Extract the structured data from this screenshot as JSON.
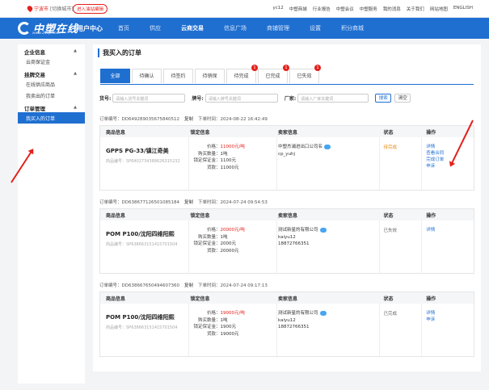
{
  "topbar": {
    "location": "宁波市",
    "location_note": "[切换城市]",
    "enter_label": "进入油站编辑",
    "links": [
      "yc12",
      "中塑商城",
      "行业报告",
      "中塑会议",
      "中塑服务",
      "我的消息",
      "关于我们",
      "网站地图",
      "ENGLISH"
    ]
  },
  "header": {
    "logo": "中塑在线",
    "logo_sub": "www.21cp.com",
    "user_center": "用户中心",
    "nav": [
      "首页",
      "供应",
      "云商交易",
      "信息广场",
      "商铺管理",
      "设置",
      "积分商城"
    ],
    "active_nav": "云商交易"
  },
  "sidebar": {
    "sections": [
      {
        "title": "企业信息",
        "items": [
          "云商保证金"
        ]
      },
      {
        "title": "挂牌交易",
        "items": [
          "在线供应商品",
          "我卖出的订单"
        ]
      },
      {
        "title": "订单管理",
        "items": [
          "我买入的订单"
        ]
      }
    ],
    "active_item": "我买入的订单"
  },
  "main": {
    "title": "我买入的订单",
    "tabs": [
      {
        "label": "全部",
        "badge": ""
      },
      {
        "label": "待确认",
        "badge": ""
      },
      {
        "label": "待签约",
        "badge": ""
      },
      {
        "label": "待销保",
        "badge": ""
      },
      {
        "label": "待完成",
        "badge": "1"
      },
      {
        "label": "已完成",
        "badge": "1"
      },
      {
        "label": "已失效",
        "badge": "1"
      }
    ],
    "filters": {
      "goods_label": "货号:",
      "goods_placeholder": "请输入货号关键词",
      "brand_label": "牌号:",
      "brand_placeholder": "请输入牌号关键词",
      "factory_label": "厂家:",
      "factory_placeholder": "请输入厂家关键词",
      "search_label": "搜索",
      "clear_label": "清空"
    },
    "columns": [
      "商品信息",
      "锁定信息",
      "卖家信息",
      "状态",
      "操作"
    ],
    "orders": [
      {
        "order_no": "订单编号：DD649289035675840512",
        "copy": "复制",
        "time": "下单时间：2024-08-22 16:42:49",
        "product": "GPPS PG-33/镇江奇美",
        "product_no": "商品编号：SP6402734388626315232",
        "price_label": "价格：",
        "price": "11000元/吨",
        "qty_label": "购买数量：",
        "qty": "1吨",
        "deposit_label": "锁定保证金：",
        "deposit": "1100元",
        "payment_label": "货款：",
        "payment": "11000元",
        "seller": "中塑杰浦进出口公司名",
        "seller2": "cp_yuhj",
        "status": "待完成",
        "ops": [
          "详情",
          "查看合同",
          "完成订单",
          "申诉"
        ]
      },
      {
        "order_no": "订单编号：DD638677126501085184",
        "copy": "复制",
        "time": "下单时间：2024-07-24 09:54:53",
        "product": "POM P100/沈阳四维阳熙",
        "product_no": "商品编号：SP638663151415701504",
        "price_label": "价格：",
        "price": "20000元/吨",
        "qty_label": "购买数量：",
        "qty": "1吨",
        "deposit_label": "锁定保证金：",
        "deposit": "2000元",
        "payment_label": "货款：",
        "payment": "20000元",
        "seller": "测试新星的有限公司",
        "seller2": "kaiyu12",
        "seller3": "18872766351",
        "status": "已失效",
        "ops": [
          "详情"
        ]
      },
      {
        "order_no": "订单编号：DD638667650494607360",
        "copy": "复制",
        "time": "下单时间：2024-07-24 09:17:13",
        "product": "POM P100/沈阳四维阳熙",
        "product_no": "商品编号：SP638663151415701504",
        "price_label": "价格：",
        "price": "19000元/吨",
        "qty_label": "购买数量：",
        "qty": "1吨",
        "deposit_label": "锁定保证金：",
        "deposit": "1900元",
        "payment_label": "货款：",
        "payment": "19000元",
        "seller": "测试新星的有限公司",
        "seller2": "kaiyu12",
        "seller3": "18872766351",
        "status": "已完成",
        "ops": [
          "详情",
          "申诉"
        ]
      }
    ]
  },
  "colors": {
    "brand": "#1f6fd1",
    "accent": "#e3201b",
    "pending": "#e88a13"
  }
}
